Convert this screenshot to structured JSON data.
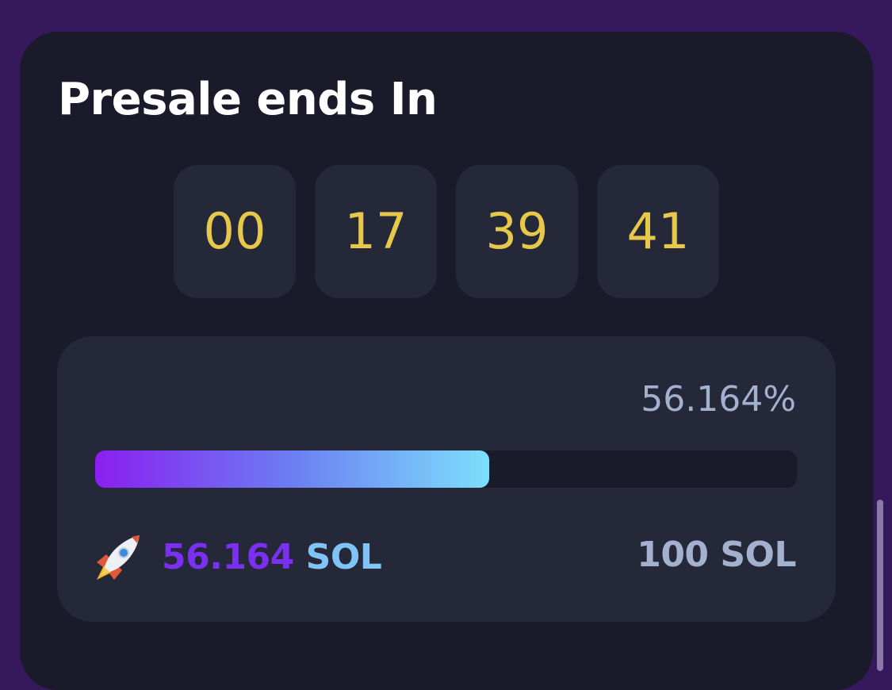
{
  "presale": {
    "title": "Presale ends In",
    "countdown": [
      "00",
      "17",
      "39",
      "41"
    ]
  },
  "progress": {
    "percent_label": "56.164%",
    "fill_fraction": 0.56164,
    "raised_value": "56.164",
    "raised_unit": "SOL",
    "goal_label": "100 SOL"
  },
  "icons": {
    "raised": "rocket-icon"
  },
  "colors": {
    "page_bg": "#36195c",
    "card_bg": "#1b1a2b",
    "panel_bg": "#242838",
    "countdown_text": "#e6c84a",
    "muted_text": "#a3b1cf",
    "gradient_start": "#8a1ff0",
    "gradient_end": "#7ddffb"
  }
}
